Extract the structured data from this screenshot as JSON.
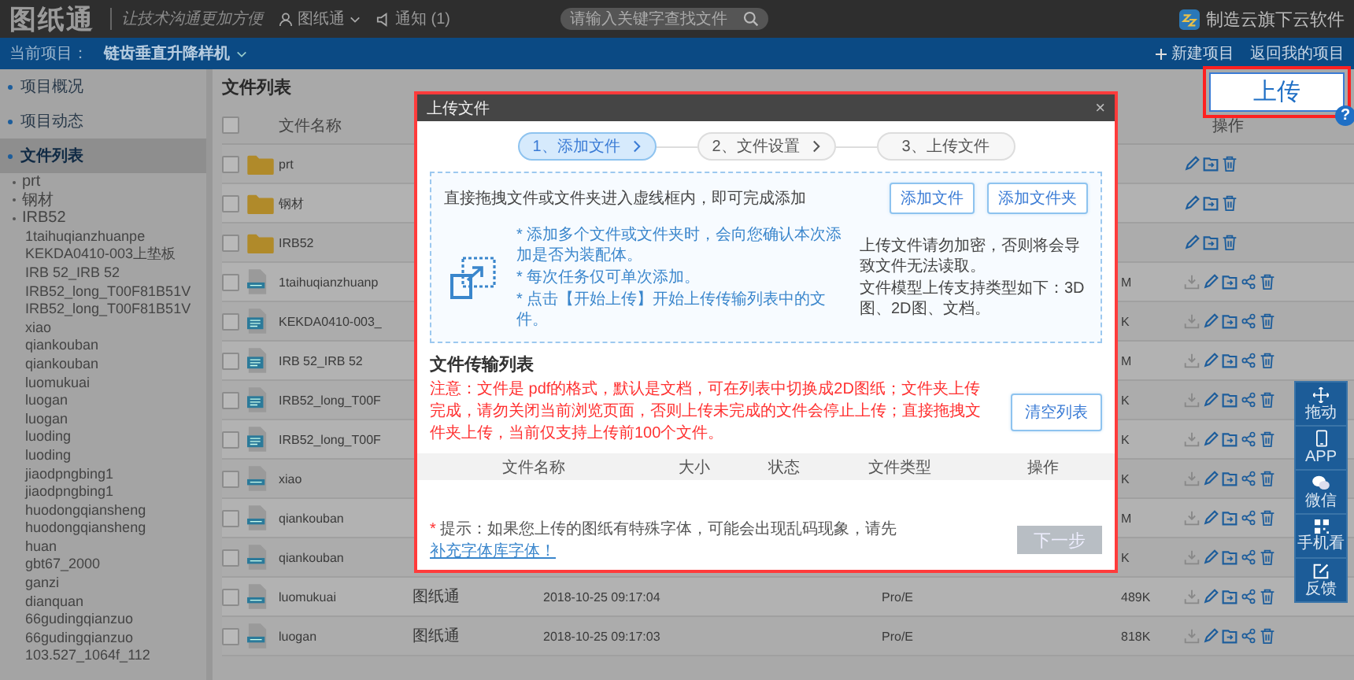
{
  "top_bar": {
    "logo": "图纸通",
    "slogan": "让技术沟通更加方便",
    "user": "图纸通",
    "notice": "通知 (1)",
    "search": {
      "placeholder": "请输入关键字查找文件"
    },
    "brand": "制造云旗下云软件"
  },
  "project_bar": {
    "label": "当前项目：",
    "project": "链齿垂直升降样机",
    "actions": [
      {
        "kind": "new",
        "label": "新建项目"
      },
      {
        "kind": "back",
        "label": "返回我的项目"
      }
    ]
  },
  "sidebar": {
    "items": [
      {
        "label": "项目概况",
        "selected": false
      },
      {
        "label": "项目动态",
        "selected": false
      },
      {
        "label": "文件列表",
        "selected": true
      }
    ],
    "folders": [
      "prt",
      "钢材",
      "IRB52"
    ],
    "files": [
      "1taihuqianzhuanpe",
      "KEKDA0410-003上垫板",
      "IRB 52_IRB 52",
      "IRB52_long_T00F81B51V",
      "IRB52_long_T00F81B51V",
      "xiao",
      "qiankouban",
      "qiankouban",
      "luomukuai",
      "luogan",
      "luogan",
      "luoding",
      "luoding",
      "jiaodpngbing1",
      "jiaodpngbing1",
      "huodongqiansheng",
      "huodongqiansheng",
      "huan",
      "gbt67_2000",
      "ganzi",
      "dianquan",
      "66gudingqianzuo",
      "66gudingqianzuo",
      "103.527_1064f_112"
    ]
  },
  "file_list": {
    "title": "文件列表",
    "select_all_checked": false,
    "columns": {
      "name": "文件名称",
      "actions": "操作"
    },
    "rows": [
      {
        "kind": "folder",
        "name": "prt",
        "checked": false
      },
      {
        "kind": "folder",
        "name": "钢材",
        "checked": false
      },
      {
        "kind": "folder",
        "name": "IRB52",
        "checked": false
      },
      {
        "kind": "proe",
        "name": "1taihuqianzhuanp",
        "size": "M",
        "checked": false
      },
      {
        "kind": "solidworks",
        "name": "KEKDA0410-003_",
        "size": "K",
        "checked": false
      },
      {
        "kind": "solidworks",
        "name": "IRB 52_IRB 52",
        "size": "M",
        "checked": false
      },
      {
        "kind": "solidworks",
        "name": "IRB52_long_T00F",
        "size": "K",
        "checked": false
      },
      {
        "kind": "solidworks",
        "name": "IRB52_long_T00F",
        "size": "K",
        "checked": false
      },
      {
        "kind": "proe",
        "name": "xiao",
        "size": "K",
        "checked": false
      },
      {
        "kind": "proe",
        "name": "qiankouban",
        "size": "M",
        "checked": false
      },
      {
        "kind": "proe",
        "name": "qiankouban",
        "size": "K",
        "checked": false
      },
      {
        "kind": "proe",
        "name": "luomukuai",
        "uploader": "图纸通",
        "date": "2018-10-25 09:17:04",
        "type": "Pro/E",
        "size": "489K",
        "checked": false
      },
      {
        "kind": "proe",
        "name": "luogan",
        "uploader": "图纸通",
        "date": "2018-10-25 09:17:03",
        "type": "Pro/E",
        "size": "818K",
        "checked": false
      }
    ]
  },
  "upload_dialog": {
    "title": "上传文件",
    "close": "×",
    "steps": [
      {
        "label": "1、添加文件",
        "selected": true,
        "arrow": true
      },
      {
        "label": "2、文件设置",
        "selected": false,
        "arrow": true
      },
      {
        "label": "3、上传文件",
        "selected": false,
        "arrow": false
      }
    ],
    "drop_zone": {
      "heading": "直接拖拽文件或文件夹进入虚线框内，即可完成添加",
      "buttons": [
        "添加文件",
        "添加文件夹"
      ],
      "tips": [
        "* 添加多个文件或文件夹时，会向您确认本次添加是否为装配体。",
        "* 每次任务仅可单次添加。",
        "* 点击【开始上传】开始上传传输列表中的文件。"
      ],
      "notes": [
        "上传文件请勿加密，否则将会导致文件无法读取。",
        "文件模型上传支持类型如下：3D图、2D图、文档。"
      ]
    },
    "transfer": {
      "title": "文件传输列表",
      "warning": "注意：文件是 pdf的格式，默认是文档，可在列表中切换成2D图纸；文件夹上传完成，请勿关闭当前浏览页面，否则上传未完成的文件会停止上传；直接拖拽文件夹上传，当前仅支持上传前100个文件。",
      "clear_button": "清空列表",
      "columns": [
        "文件名称",
        "大小",
        "状态",
        "文件类型",
        "操作"
      ]
    },
    "footer": {
      "mark": "*",
      "text": "提示：如果您上传的图纸有特殊字体，可能会出现乱码现象，请先",
      "link": "补充字体库字体！"
    },
    "next_button": {
      "label": "下一步",
      "disabled": true
    }
  },
  "upload_guide": {
    "label": "上传",
    "help": "?"
  },
  "float_bar": [
    {
      "kind": "move",
      "label": "拖动"
    },
    {
      "kind": "phone",
      "label": "APP"
    },
    {
      "kind": "wechat",
      "label": "微信"
    },
    {
      "kind": "qr",
      "label": "手机看"
    },
    {
      "kind": "feedback",
      "label": "反馈"
    }
  ]
}
